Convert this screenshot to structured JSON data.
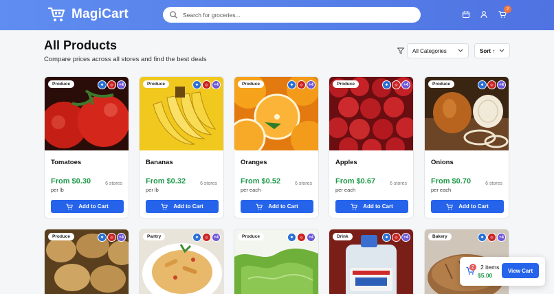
{
  "header": {
    "brand": "MagiCart",
    "search_placeholder": "Search for groceries...",
    "cart_count": "2"
  },
  "page": {
    "title": "All Products",
    "subtitle": "Compare prices across all stores and find the best deals",
    "category_filter": "All Categories",
    "sort_label": "Sort ↑"
  },
  "store_icons": {
    "more_label": "+4"
  },
  "products_row1": [
    {
      "category": "Produce",
      "name": "Tomatoes",
      "price": "From $0.30",
      "unit": "per lb",
      "stores": "6 stores",
      "button": "Add to Cart"
    },
    {
      "category": "Produce",
      "name": "Bananas",
      "price": "From $0.32",
      "unit": "per lb",
      "stores": "6 stores",
      "button": "Add to Cart"
    },
    {
      "category": "Produce",
      "name": "Oranges",
      "price": "From $0.52",
      "unit": "per each",
      "stores": "6 stores",
      "button": "Add to Cart"
    },
    {
      "category": "Produce",
      "name": "Apples",
      "price": "From $0.67",
      "unit": "per each",
      "stores": "6 stores",
      "button": "Add to Cart"
    },
    {
      "category": "Produce",
      "name": "Onions",
      "price": "From $0.70",
      "unit": "per each",
      "stores": "6 stores",
      "button": "Add to Cart"
    }
  ],
  "products_row2": [
    {
      "category": "Produce"
    },
    {
      "category": "Pantry"
    },
    {
      "category": "Produce"
    },
    {
      "category": "Drink"
    },
    {
      "category": "Bakery"
    }
  ],
  "floating_cart": {
    "count": "2",
    "items_label": "2 items",
    "total": "$5.00",
    "button": "View Cart"
  },
  "colors": {
    "header": "#5a85ec",
    "accent": "#2563eb",
    "price": "#1f9a4a",
    "badge": "#f0733c"
  }
}
